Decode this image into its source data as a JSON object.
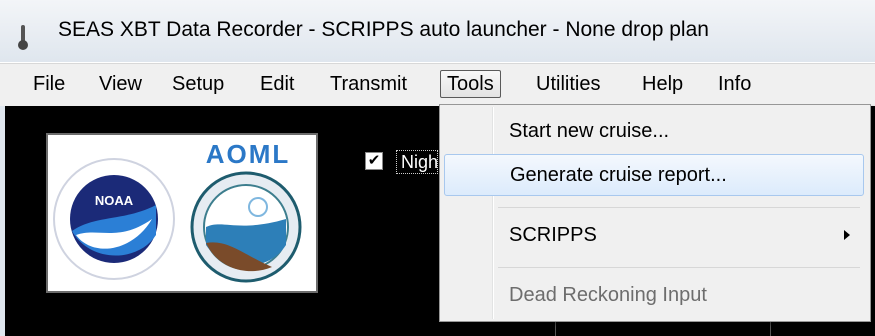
{
  "window": {
    "title": "SEAS XBT Data Recorder - SCRIPPS auto launcher - None drop plan"
  },
  "menubar": {
    "items": [
      "File",
      "View",
      "Setup",
      "Edit",
      "Transmit",
      "Tools",
      "Utilities",
      "Help",
      "Info"
    ],
    "active": "Tools"
  },
  "logos": {
    "noaa_text": "NOAA",
    "aoml_text": "AOML"
  },
  "content": {
    "night_checkbox_checked": true,
    "night_label": "Night mode"
  },
  "tools_menu": {
    "items": [
      {
        "label": "Start new cruise...",
        "state": "normal"
      },
      {
        "label": "Generate cruise report...",
        "state": "highlighted"
      },
      {
        "label": "SCRIPPS",
        "state": "submenu"
      },
      {
        "label": "Dead Reckoning Input",
        "state": "disabled"
      }
    ]
  },
  "colors": {
    "content_bg": "#000000",
    "highlight_border": "#a8c8ee",
    "aoml_blue": "#2b78c7",
    "noaa_navy": "#1b2a78"
  }
}
